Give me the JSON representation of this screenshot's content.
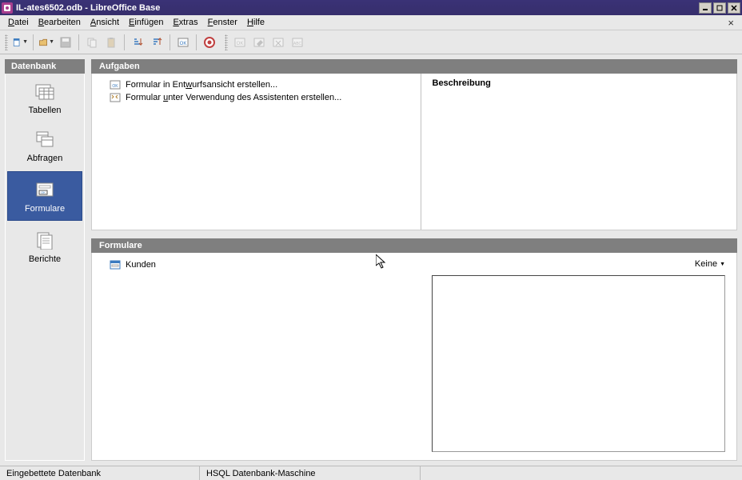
{
  "titlebar": {
    "filename": "IL-ates6502.odb",
    "appname": "LibreOffice Base"
  },
  "menubar": {
    "items": [
      {
        "label": "Datei",
        "ul": "D",
        "rest": "atei"
      },
      {
        "label": "Bearbeiten",
        "ul": "B",
        "rest": "earbeiten"
      },
      {
        "label": "Ansicht",
        "ul": "A",
        "rest": "nsicht"
      },
      {
        "label": "Einfügen",
        "ul": "E",
        "rest": "infügen"
      },
      {
        "label": "Extras",
        "ul": "E",
        "rest": "xtras"
      },
      {
        "label": "Fenster",
        "ul": "F",
        "rest": "enster"
      },
      {
        "label": "Hilfe",
        "ul": "H",
        "rest": "ilfe"
      }
    ]
  },
  "sidebar": {
    "header": "Datenbank",
    "items": [
      {
        "label": "Tabellen",
        "name": "tables"
      },
      {
        "label": "Abfragen",
        "name": "queries"
      },
      {
        "label": "Formulare",
        "name": "forms",
        "active": true
      },
      {
        "label": "Berichte",
        "name": "reports"
      }
    ]
  },
  "tasks": {
    "header": "Aufgaben",
    "items": [
      {
        "pre": "Formular in Ent",
        "ul": "w",
        "post": "urfsansicht erstellen..."
      },
      {
        "pre": "Formular ",
        "ul": "u",
        "post": "nter Verwendung des Assistenten erstellen..."
      }
    ],
    "desc_label": "Beschreibung"
  },
  "list": {
    "header": "Formulare",
    "items": [
      {
        "label": "Kunden"
      }
    ],
    "view_label": "Keine"
  },
  "statusbar": {
    "left": "Eingebettete Datenbank",
    "mid": "HSQL Datenbank-Maschine"
  }
}
